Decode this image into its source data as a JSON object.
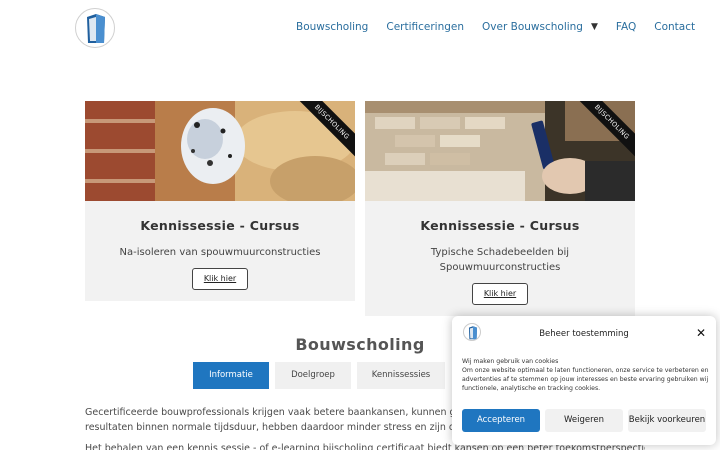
{
  "nav": {
    "items": [
      "Bouwscholing",
      "Certificeringen",
      "Over Bouwscholing",
      "FAQ",
      "Contact"
    ],
    "caret": "▼"
  },
  "cards": [
    {
      "ribbon": "BIJSCHOLING",
      "title": "Kennissessie - Cursus",
      "desc": "Na-isoleren van spouwmuurconstructies",
      "button": "Klik hier"
    },
    {
      "ribbon": "BIJSCHOLING",
      "title": "Kennissessie - Cursus",
      "desc": "Typische Schadebeelden bij Spouwmuurconstructies",
      "button": "Klik hier"
    }
  ],
  "section": {
    "title": "Bouwscholing",
    "tabs": [
      "Informatie",
      "Doelgroep",
      "Kennissessies"
    ],
    "active_tab": "Informatie",
    "para1_line1": "Gecertificeerde bouwprofessionals krijgen vaak betere baankansen, kunnen goed",
    "para1_line2": "resultaten binnen normale tijdsduur, hebben daardoor minder stress en zijn ook m",
    "para2": "Het behalen van een kennis sessie - of e-learning bijscholing certificaat biedt kansen op een beter toekomstperspectief"
  },
  "cookie": {
    "title": "Beheer toestemming",
    "close": "✕",
    "line1": "Wij maken gebruik van cookies",
    "body": "Om onze website optimaal te laten functioneren, onze service te verbeteren en advertenties af te stemmen op jouw interesses en beste ervaring gebruiken wij functionele, analytische en tracking cookies.",
    "accept": "Accepteren",
    "deny": "Weigeren",
    "prefs": "Bekijk voorkeuren"
  },
  "colors": {
    "accent": "#1f76c0",
    "link": "#2a6e9e",
    "card_bg": "#f2f2f2"
  }
}
